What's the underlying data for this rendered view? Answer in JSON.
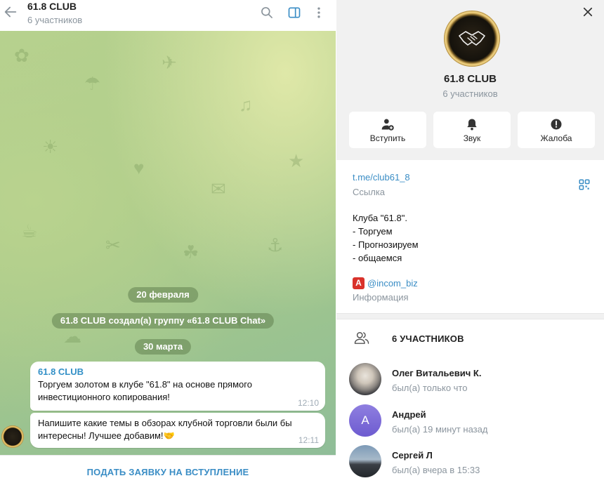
{
  "chat": {
    "title": "61.8 CLUB",
    "subtitle": "6 участников",
    "dates": [
      "20 февраля",
      "30 марта"
    ],
    "service_message": "61.8 CLUB создал(а) группу «61.8 CLUB Chat»",
    "messages": [
      {
        "sender": "61.8 CLUB",
        "text": "Торгуем золотом в клубе \"61.8\" на основе прямого инвестиционного копирования!",
        "time": "12:10"
      },
      {
        "text": "Напишите какие темы в обзорах клубной торговли были бы интересны! Лучшее добавим!🤝",
        "time": "12:11"
      }
    ],
    "join_request_label": "ПОДАТЬ ЗАЯВКУ НА ВСТУПЛЕНИЕ"
  },
  "info": {
    "title": "61.8 CLUB",
    "subtitle": "6 участников",
    "actions": [
      {
        "label": "Вступить",
        "icon": "add-user-icon"
      },
      {
        "label": "Звук",
        "icon": "bell-icon"
      },
      {
        "label": "Жалоба",
        "icon": "report-icon"
      }
    ],
    "link": "t.me/club61_8",
    "link_caption": "Ссылка",
    "description": "Клуба \"61.8\".\n- Торгуем\n- Прогнозируем\n- общаемся",
    "mention_badge": "A",
    "mention": "@incom_biz",
    "mention_caption": "Информация",
    "members_header": "6 УЧАСТНИКОВ",
    "members": [
      {
        "name": "Олег Витальевич К.",
        "status": "был(а) только что"
      },
      {
        "name": "Андрей",
        "status": "был(а) 19 минут назад",
        "initial": "А"
      },
      {
        "name": "Сергей Л",
        "status": "был(а) вчера в 15:33"
      }
    ]
  },
  "colors": {
    "accent": "#3a8dc5",
    "secondary_text": "#8b959e",
    "report_badge": "#d9322b"
  }
}
